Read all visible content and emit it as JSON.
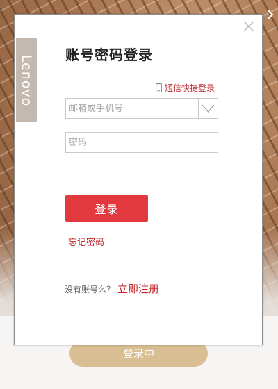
{
  "window": {
    "background_button_label": "登录中"
  },
  "brand": {
    "logo_text": "Lenovo",
    "strip_color": "#c4b9b0"
  },
  "dialog": {
    "title": "账号密码登录",
    "close_icon": "close-icon",
    "sms_login": {
      "icon": "phone-icon",
      "label": "短信快捷登录"
    },
    "account_field": {
      "placeholder": "邮箱或手机号",
      "value": "",
      "dropdown_icon": "chevron-down-icon"
    },
    "password_field": {
      "placeholder": "密码",
      "value": ""
    },
    "login_button": "登录",
    "forgot_password": "忘记密码",
    "register": {
      "prompt": "没有账号么？",
      "link": "立即注册"
    }
  },
  "colors": {
    "accent_red": "#e2393e",
    "link_red": "#c1282d",
    "tan_button": "#d9be93"
  }
}
